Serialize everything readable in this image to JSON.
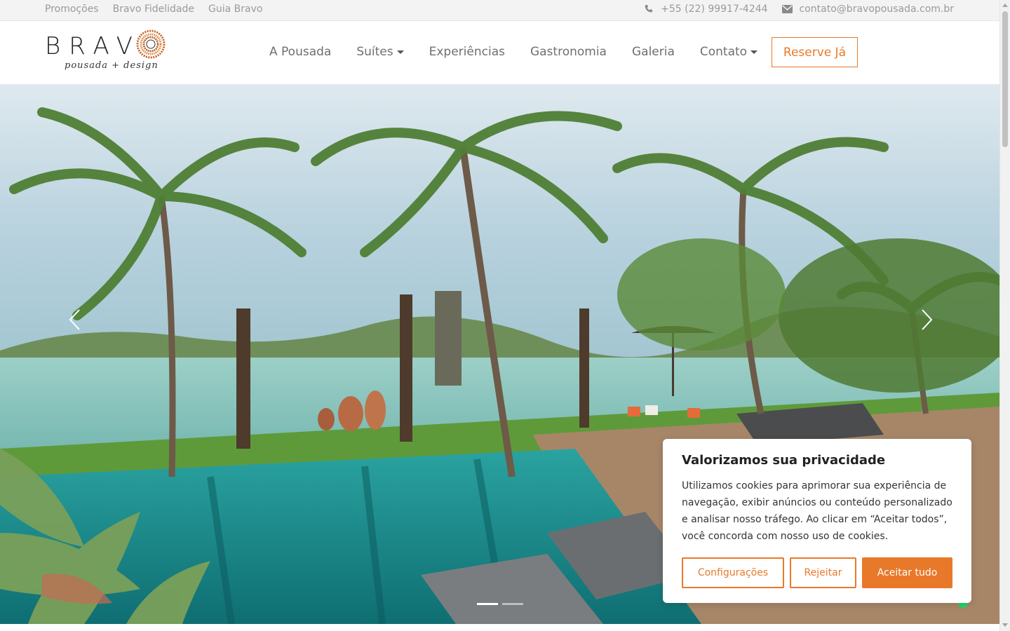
{
  "topbar": {
    "links": [
      "Promoções",
      "Bravo Fidelidade",
      "Guia Bravo"
    ],
    "phone_icon": "phone-icon",
    "phone": "+55 (22) 99917-4244",
    "email_icon": "envelope-icon",
    "email": "contato@bravopousada.com.br"
  },
  "logo": {
    "word": "BRAV",
    "tagline": "pousada + design",
    "mark_icon": "sun-mandala-icon"
  },
  "nav": {
    "items": [
      {
        "label": "A Pousada",
        "dropdown": false
      },
      {
        "label": "Suítes",
        "dropdown": true
      },
      {
        "label": "Experiências",
        "dropdown": false
      },
      {
        "label": "Gastronomia",
        "dropdown": false
      },
      {
        "label": "Galeria",
        "dropdown": false
      },
      {
        "label": "Contato",
        "dropdown": true
      }
    ],
    "reserve_label": "Reserve Já"
  },
  "hero": {
    "prev_icon": "chevron-left-icon",
    "next_icon": "chevron-right-icon",
    "slides": 2,
    "active_slide": 1
  },
  "cookie": {
    "title": "Valorizamos sua privacidade",
    "text": "Utilizamos cookies para aprimorar sua experiência de navegação, exibir anúncios ou conteúdo personalizado e analisar nosso tráfego. Ao clicar em “Aceitar todos”, você concorda com nosso uso de cookies.",
    "settings_label": "Configurações",
    "reject_label": "Rejeitar",
    "accept_label": "Aceitar tudo"
  },
  "colors": {
    "accent": "#e8792a",
    "topbar_bg": "#f3f3f3",
    "nav_text": "#6f6f6f"
  }
}
